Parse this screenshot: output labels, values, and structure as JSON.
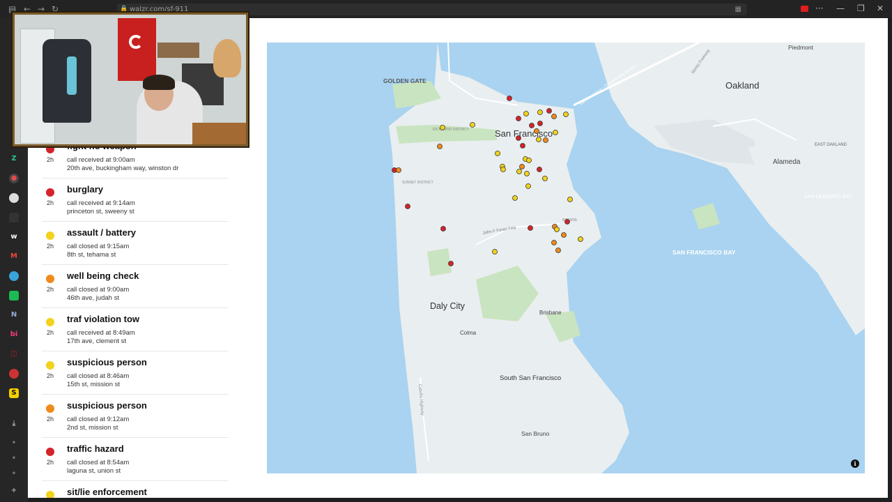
{
  "browser": {
    "url": "walzr.com/sf-911"
  },
  "incidents": [
    {
      "title": "fight no weapon",
      "age": "2h",
      "status": "call received at 9:00am",
      "location": "20th ave, buckingham way, winston dr",
      "color": "#d4232b"
    },
    {
      "title": "burglary",
      "age": "2h",
      "status": "call received at 9:14am",
      "location": "princeton st, sweeny st",
      "color": "#d4232b"
    },
    {
      "title": "assault / battery",
      "age": "2h",
      "status": "call closed at 9:15am",
      "location": "8th st, tehama st",
      "color": "#f2d21b"
    },
    {
      "title": "well being check",
      "age": "2h",
      "status": "call closed at 9:00am",
      "location": "46th ave, judah st",
      "color": "#ef8a1c"
    },
    {
      "title": "traf violation tow",
      "age": "2h",
      "status": "call received at 8:49am",
      "location": "17th ave, clement st",
      "color": "#f2d21b"
    },
    {
      "title": "suspicious person",
      "age": "2h",
      "status": "call closed at 8:46am",
      "location": "15th st, mission st",
      "color": "#f2d21b"
    },
    {
      "title": "suspicious person",
      "age": "2h",
      "status": "call closed at 9:12am",
      "location": "2nd st, mission st",
      "color": "#ef8a1c"
    },
    {
      "title": "traffic hazard",
      "age": "2h",
      "status": "call closed at 8:54am",
      "location": "laguna st, union st",
      "color": "#d4232b"
    },
    {
      "title": "sit/lie enforcement",
      "age": "",
      "status": "",
      "location": "",
      "color": "#f2d21b"
    }
  ],
  "map": {
    "labels": {
      "golden_gate": "GOLDEN GATE",
      "san_francisco": "San Francisco",
      "oakland": "Oakland",
      "piedmont": "Piedmont",
      "alameda": "Alameda",
      "east_oakland": "EAST OAKLAND",
      "san_leandro_bay": "SAN LEANDRO BAY",
      "sf_bay": "SAN FRANCISCO BAY",
      "daly_city": "Daly City",
      "brisbane": "Brisbane",
      "colma": "Colma",
      "south_sf": "South San Francisco",
      "san_bruno": "San Bruno",
      "sunset": "SUNSET DISTRICT",
      "richmond": "RICHMOND DISTRICT",
      "bay_bridge": "San Francisco - Oakland Bay Bridge",
      "nimitz": "Nimitz Freeway",
      "cabrillo": "Cabrillo Highway",
      "john_f_foran": "John F Foran Fwy",
      "bayside": "BAYSIDE"
    },
    "attribution_icon": "info-icon",
    "colors": {
      "water": "#a9d3f0",
      "land": "#e9eef0",
      "park": "#c9e4c0",
      "red": "#d4232b",
      "orange": "#ef8a1c",
      "yellow": "#f2d21b"
    }
  }
}
